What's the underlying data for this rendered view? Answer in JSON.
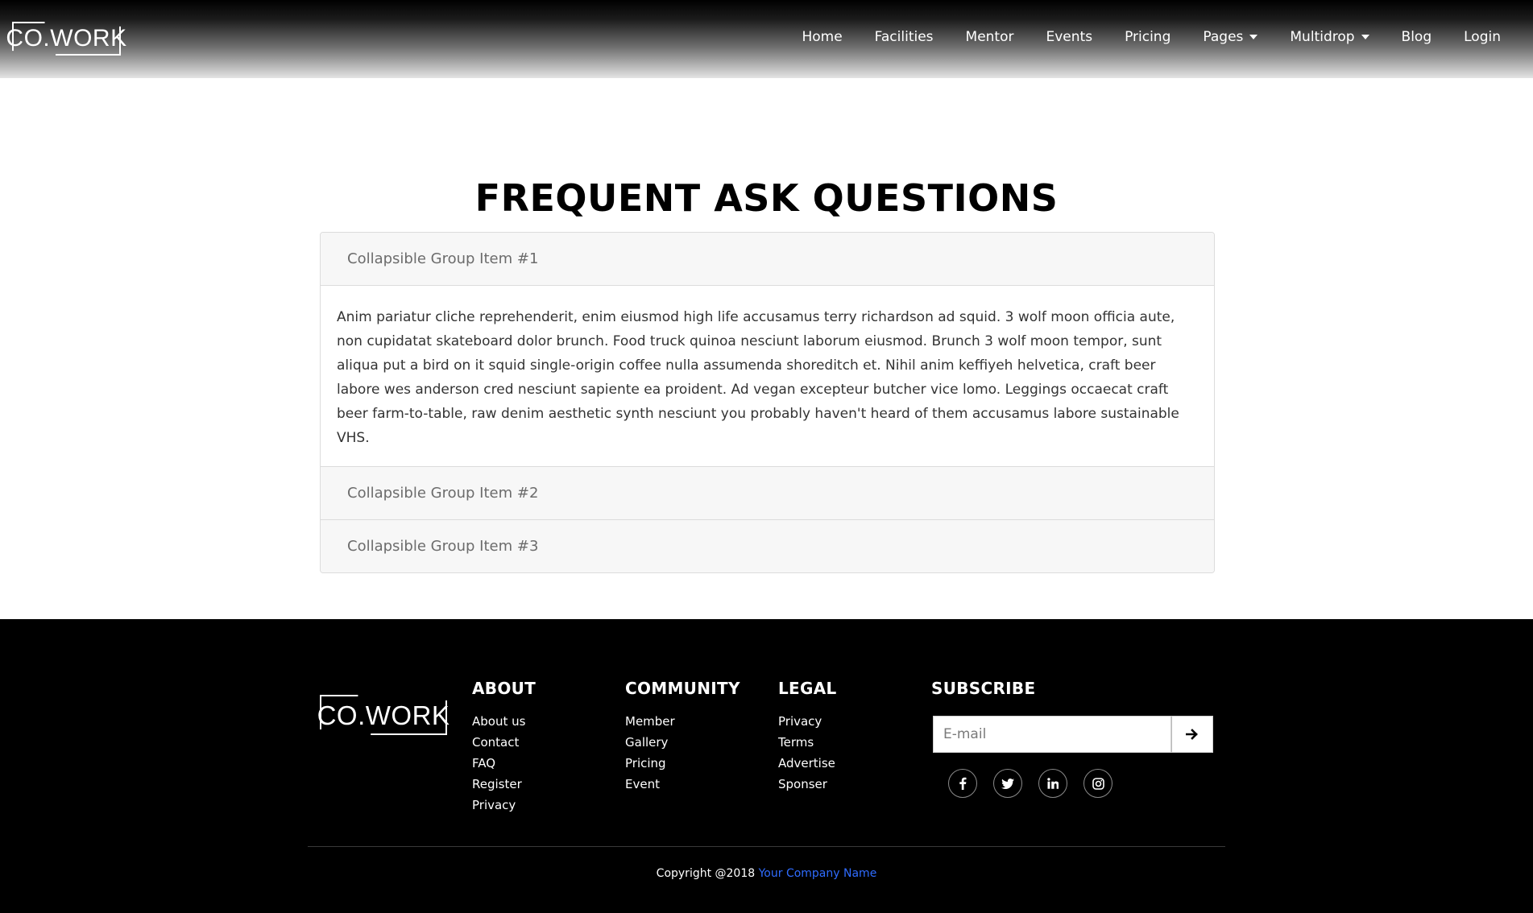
{
  "brand": {
    "logo_text": "CO.WORK"
  },
  "nav": {
    "items": [
      {
        "label": "Home"
      },
      {
        "label": "Facilities"
      },
      {
        "label": "Mentor"
      },
      {
        "label": "Events"
      },
      {
        "label": "Pricing"
      },
      {
        "label": "Pages",
        "dropdown": true
      },
      {
        "label": "Multidrop",
        "dropdown": true
      },
      {
        "label": "Blog"
      },
      {
        "label": "Login"
      }
    ]
  },
  "faq": {
    "title": "FREQUENT ASK QUESTIONS",
    "items": [
      {
        "header": "Collapsible Group Item #1",
        "expanded": true,
        "body": "Anim pariatur cliche reprehenderit, enim eiusmod high life accusamus terry richardson ad squid. 3 wolf moon officia aute, non cupidatat skateboard dolor brunch. Food truck quinoa nesciunt laborum eiusmod. Brunch 3 wolf moon tempor, sunt aliqua put a bird on it squid single-origin coffee nulla assumenda shoreditch et. Nihil anim keffiyeh helvetica, craft beer labore wes anderson cred nesciunt sapiente ea proident. Ad vegan excepteur butcher vice lomo. Leggings occaecat craft beer farm-to-table, raw denim aesthetic synth nesciunt you probably haven't heard of them accusamus labore sustainable VHS."
      },
      {
        "header": "Collapsible Group Item #2",
        "expanded": false
      },
      {
        "header": "Collapsible Group Item #3",
        "expanded": false
      }
    ]
  },
  "footer": {
    "about": {
      "heading": "ABOUT",
      "links": [
        "About us",
        "Contact",
        "FAQ",
        "Register",
        "Privacy"
      ]
    },
    "community": {
      "heading": "COMMUNITY",
      "links": [
        "Member",
        "Gallery",
        "Pricing",
        "Event"
      ]
    },
    "legal": {
      "heading": "LEGAL",
      "links": [
        "Privacy",
        "Terms",
        "Advertise",
        "Sponser"
      ]
    },
    "subscribe": {
      "heading": "SUBSCRIBE",
      "placeholder": "E-mail",
      "button_icon": "arrow-right-icon"
    },
    "socials": [
      {
        "icon": "facebook-icon",
        "glyph": "f"
      },
      {
        "icon": "twitter-icon",
        "glyph": "t"
      },
      {
        "icon": "linkedin-icon",
        "glyph": "in"
      },
      {
        "icon": "instagram-icon",
        "glyph": "ig"
      }
    ],
    "copyright_prefix": "Copyright @2018 ",
    "company_name": "Your Company Name",
    "company_color": "#2f6cff"
  }
}
